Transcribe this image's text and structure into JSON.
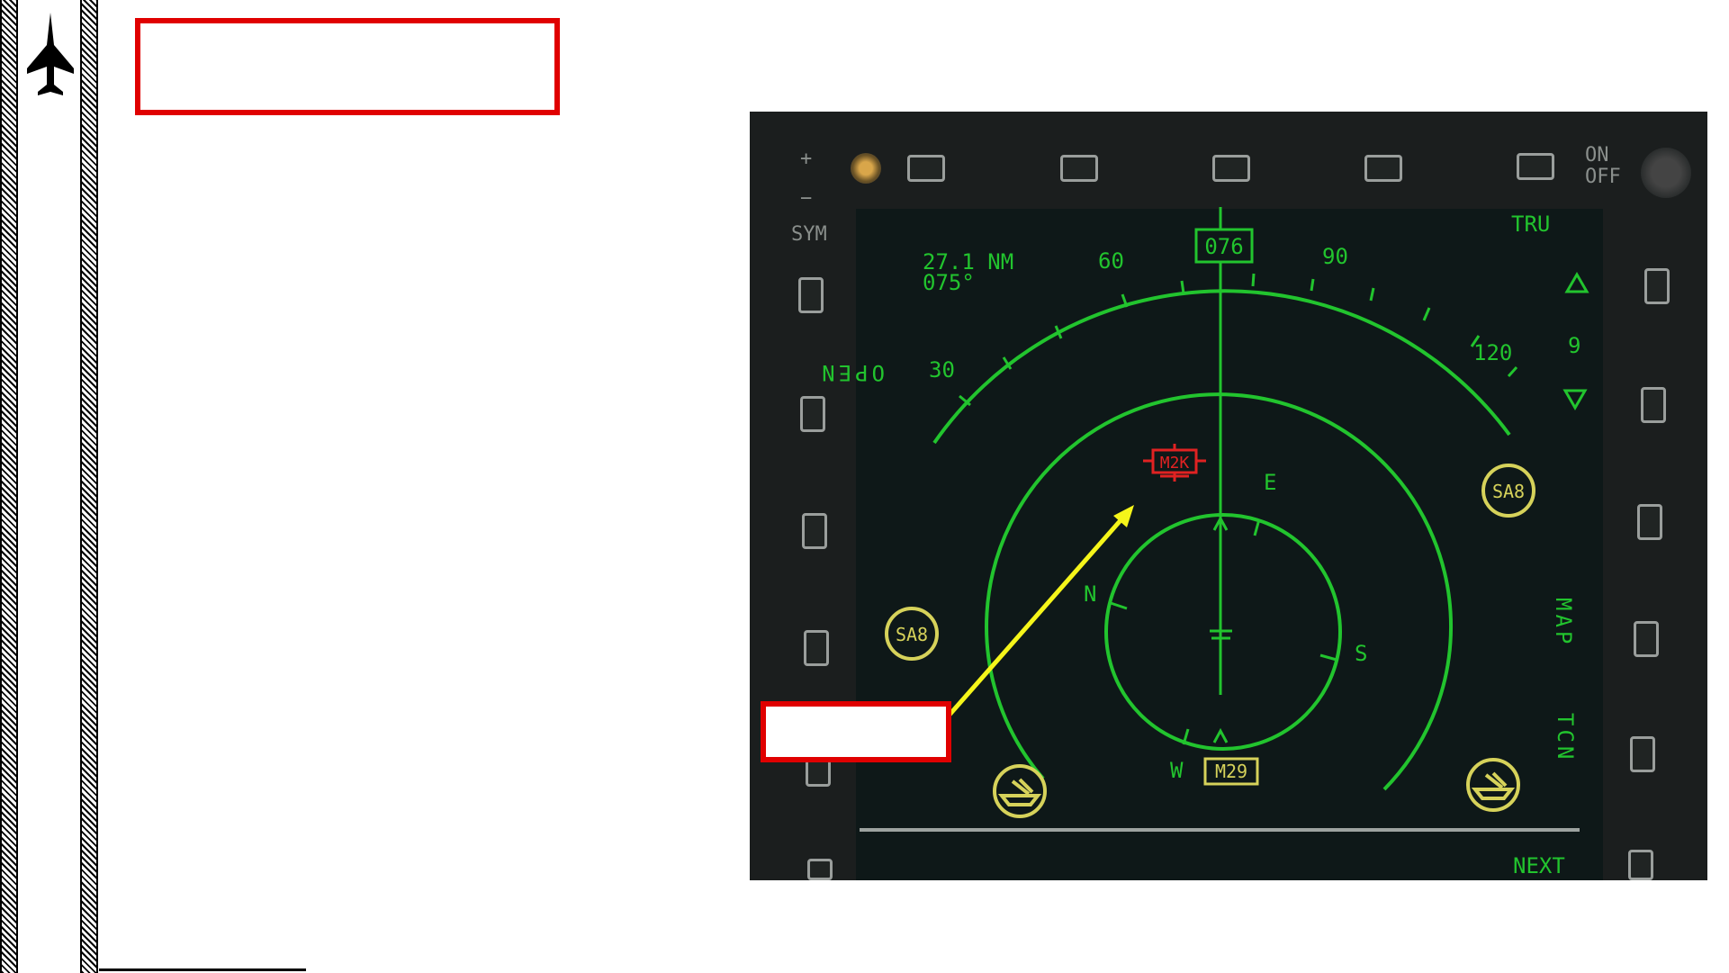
{
  "sidebar": {
    "icon": "jet-icon"
  },
  "callouts": {
    "top_box": "",
    "screen_box": ""
  },
  "mfd": {
    "frame_labels": {
      "plus": "+",
      "minus": "−",
      "sym": "SYM",
      "on": "ON",
      "off": "OFF"
    },
    "range": "27.1 NM",
    "bearing": "075°",
    "heading_box": "076",
    "mode": "TRU",
    "compass": {
      "t30": "30",
      "t60": "60",
      "t90": "90",
      "t120": "120"
    },
    "rose": {
      "n": "N",
      "e": "E",
      "s": "S",
      "w": "W"
    },
    "open": "OPEN",
    "scale_value": "9",
    "map": "MAP",
    "tcn": "TCN",
    "next": "NEXT",
    "contacts": {
      "m2k": "M2K",
      "m29": "M29",
      "sa8_left": "SA8",
      "sa8_right": "SA8"
    },
    "colors": {
      "symbology": "#22c42e",
      "hostile": "#e02222",
      "threat": "#d6d25a",
      "callout": "#e00000",
      "arrow": "#f5f51a"
    }
  }
}
